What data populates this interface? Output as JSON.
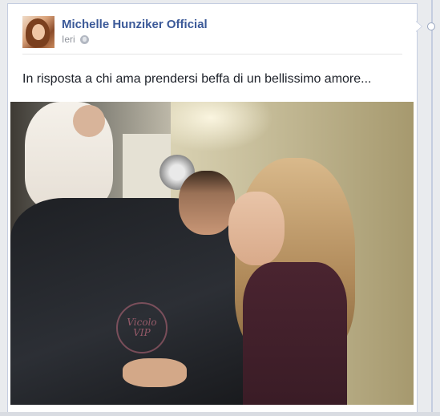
{
  "post": {
    "page_name": "Michelle Hunziker Official",
    "timestamp": "Ieri",
    "privacy_icon": "globe-icon",
    "text": "In risposta a chi ama prendersi beffa di un bellissimo amore..."
  },
  "colors": {
    "page_name": "#3b5998",
    "background": "#e9ebee",
    "card_border": "#c4cde0"
  }
}
